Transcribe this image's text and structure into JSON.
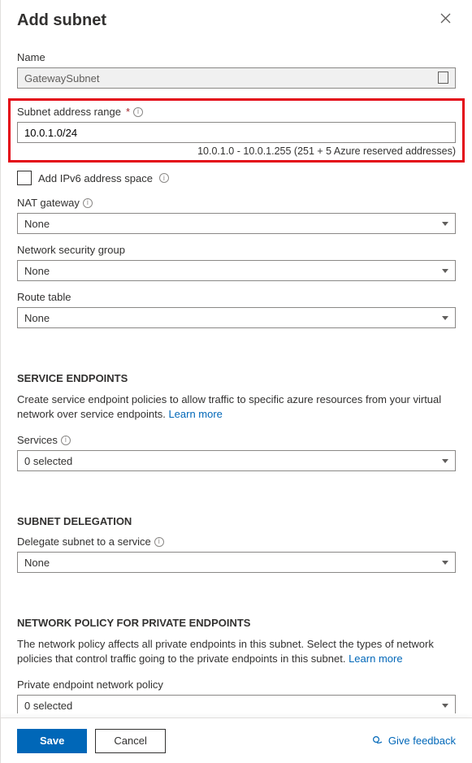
{
  "header": {
    "title": "Add subnet"
  },
  "name": {
    "label": "Name",
    "value": "GatewaySubnet"
  },
  "subnet_range": {
    "label": "Subnet address range",
    "value": "10.0.1.0/24",
    "help": "10.0.1.0 - 10.0.1.255 (251 + 5 Azure reserved addresses)"
  },
  "ipv6_checkbox": {
    "label": "Add IPv6 address space"
  },
  "nat_gateway": {
    "label": "NAT gateway",
    "value": "None"
  },
  "nsg": {
    "label": "Network security group",
    "value": "None"
  },
  "route_table": {
    "label": "Route table",
    "value": "None"
  },
  "service_endpoints": {
    "heading": "SERVICE ENDPOINTS",
    "description": "Create service endpoint policies to allow traffic to specific azure resources from your virtual network over service endpoints.",
    "learn_more": "Learn more",
    "services_label": "Services",
    "services_value": "0 selected"
  },
  "subnet_delegation": {
    "heading": "SUBNET DELEGATION",
    "label": "Delegate subnet to a service",
    "value": "None"
  },
  "network_policy": {
    "heading": "NETWORK POLICY FOR PRIVATE ENDPOINTS",
    "description": "The network policy affects all private endpoints in this subnet. Select the types of network policies that control traffic going to the private endpoints in this subnet.",
    "learn_more": "Learn more",
    "label": "Private endpoint network policy",
    "value": "0 selected"
  },
  "footer": {
    "save": "Save",
    "cancel": "Cancel",
    "feedback": "Give feedback"
  }
}
